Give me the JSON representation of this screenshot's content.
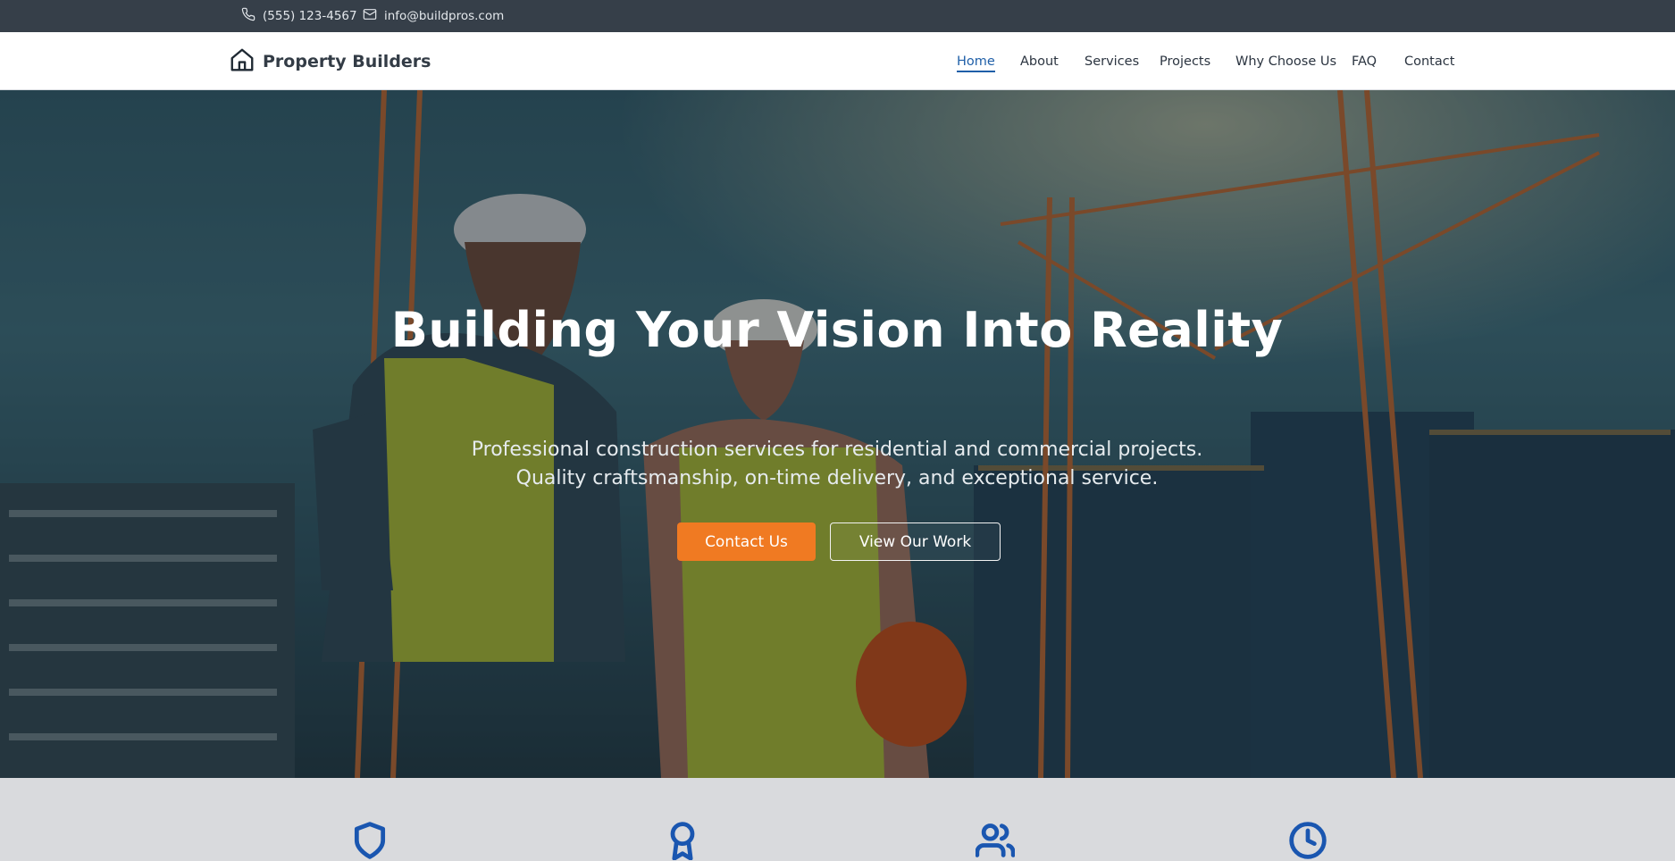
{
  "topbar": {
    "phone": "(555) 123-4567",
    "email": "info@buildpros.com",
    "phone_icon": "phone-icon",
    "email_icon": "mail-icon"
  },
  "brand": {
    "name": "Property Builders",
    "icon": "house-icon"
  },
  "nav": {
    "items": [
      {
        "label": "Home",
        "active": true
      },
      {
        "label": "About",
        "active": false
      },
      {
        "label": "Services",
        "active": false
      },
      {
        "label": "Projects",
        "active": false
      },
      {
        "label": "Why Choose Us",
        "active": false
      },
      {
        "label": "FAQ",
        "active": false
      },
      {
        "label": "Contact",
        "active": false
      }
    ]
  },
  "hero": {
    "title": "Building Your Vision Into Reality",
    "subtitle_line1": "Professional construction services for residential and commercial projects.",
    "subtitle_line2": "Quality craftsmanship, on-time delivery, and exceptional service.",
    "primary_button": "Contact Us",
    "secondary_button": "View Our Work"
  },
  "features": {
    "icons": [
      "shield-icon",
      "award-icon",
      "users-icon",
      "clock-icon"
    ]
  },
  "colors": {
    "accent": "#f07a22",
    "brand_blue": "#1f5fa8",
    "icon_blue": "#1a56b0",
    "topbar_bg": "#363f49",
    "features_bg": "#d9dadd"
  }
}
